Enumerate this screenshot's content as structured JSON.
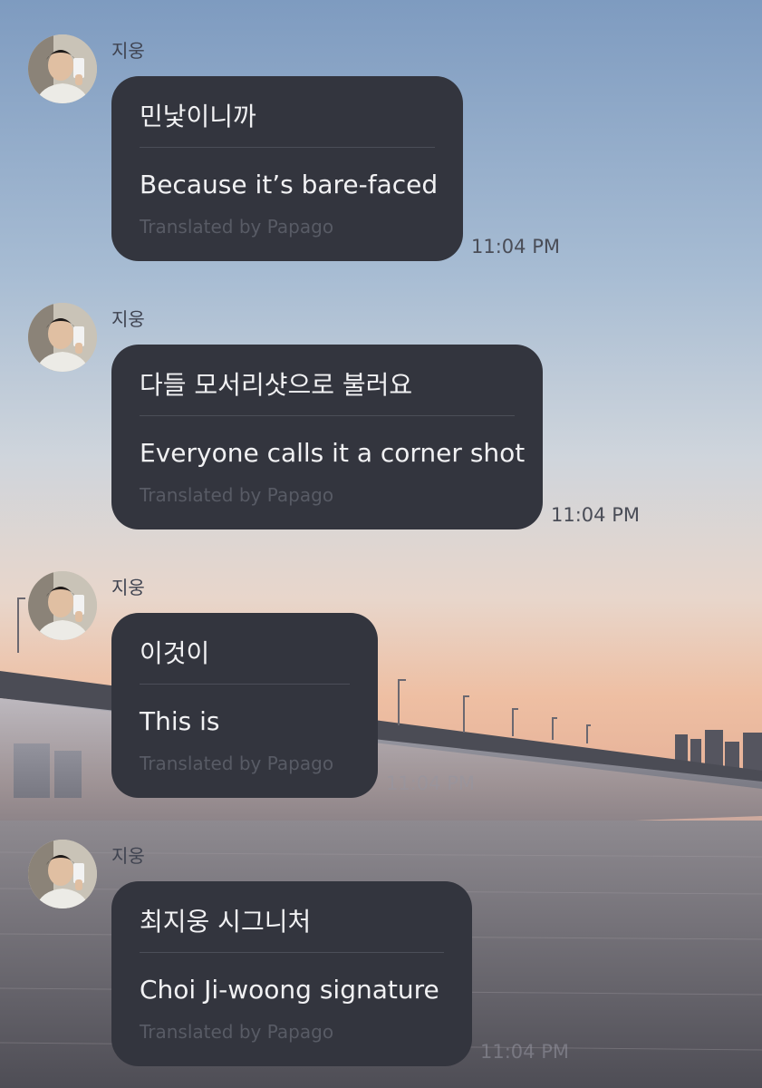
{
  "messages": [
    {
      "sender": "지웅",
      "korean": "민낯이니까",
      "english": "Because it’s bare-faced",
      "credit": "Translated by Papago",
      "time": "11:04 PM"
    },
    {
      "sender": "지웅",
      "korean": "다들 모서리샷으로 불러요",
      "english": "Everyone calls it a corner shot",
      "credit": "Translated by Papago",
      "time": "11:04 PM"
    },
    {
      "sender": "지웅",
      "korean": "이것이",
      "english": "This is",
      "credit": "Translated by Papago",
      "time": "11:04 PM"
    },
    {
      "sender": "지웅",
      "korean": "최지웅 시그니처",
      "english": "Choi Ji-woong signature",
      "credit": "Translated by Papago",
      "time": "11:04 PM"
    }
  ],
  "colors": {
    "bubble": "#33353e",
    "bubble_text": "#f1f1f3",
    "credit_text": "#585b65",
    "sky_top": "#7f9cc0",
    "sky_horizon": "#e9b69a",
    "water": "#5b5a62"
  },
  "icons": [
    "avatar-photo"
  ]
}
